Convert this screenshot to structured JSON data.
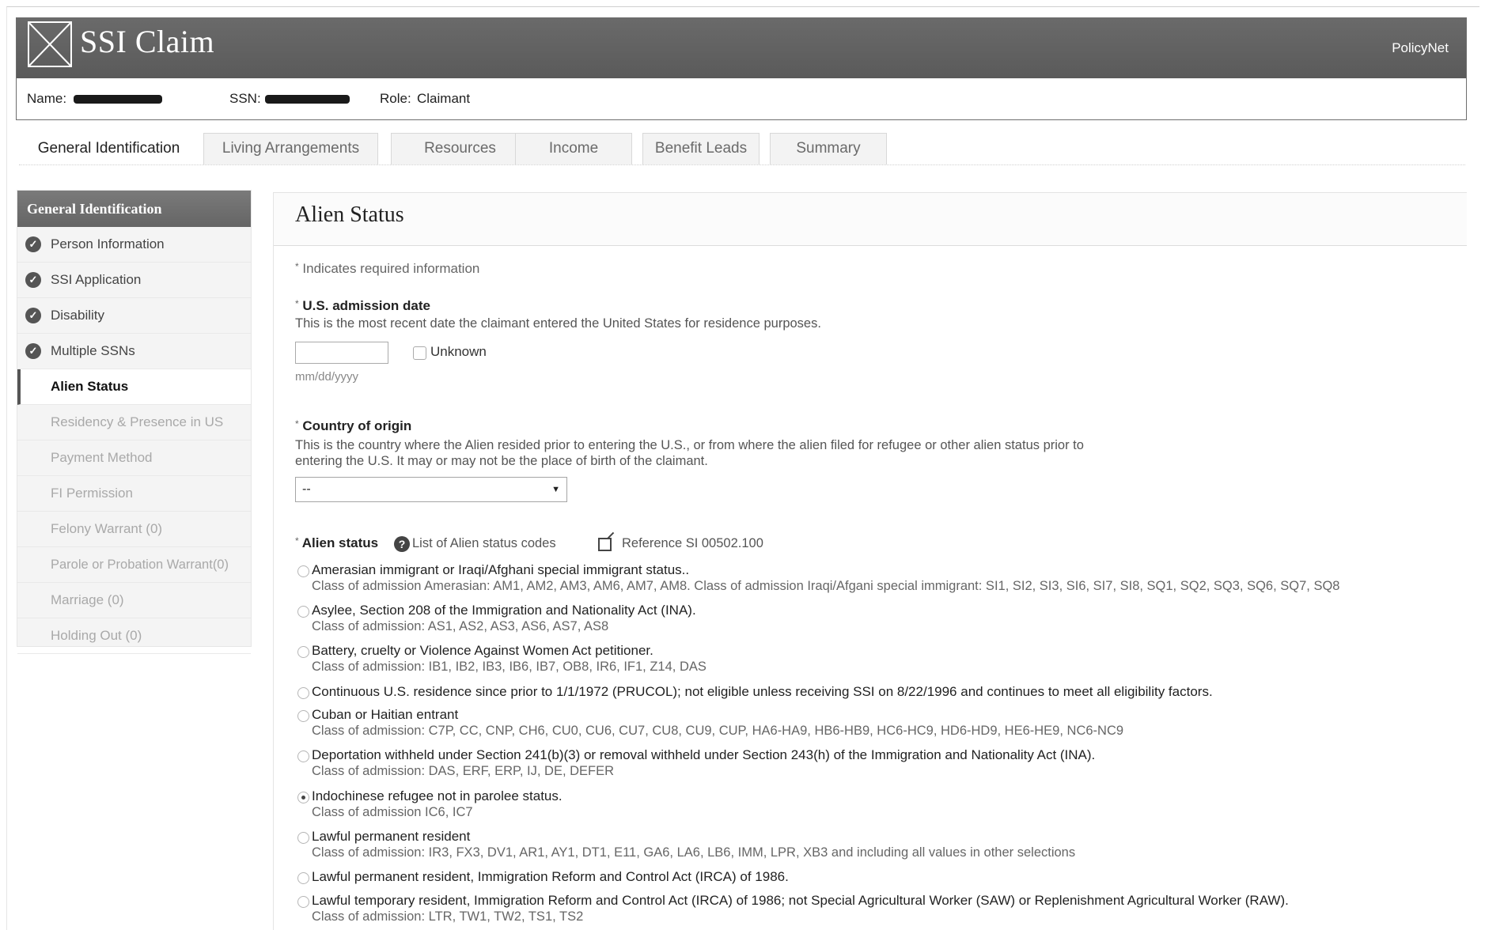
{
  "app": {
    "title": "SSI Claim",
    "vendor": "PolicyNet"
  },
  "claimant": {
    "name_label": "Name:",
    "ssn_label": "SSN:",
    "role_label": "Role:",
    "role_value": "Claimant"
  },
  "tabs": [
    {
      "label": "General Identification"
    },
    {
      "label": "Living Arrangements"
    },
    {
      "label": "Resources"
    },
    {
      "label": "Income"
    },
    {
      "label": "Benefit Leads"
    },
    {
      "label": "Summary"
    }
  ],
  "sidebar": {
    "header": "General Identification",
    "items": [
      {
        "label": "Person Information",
        "state": "complete"
      },
      {
        "label": "SSI Application",
        "state": "complete"
      },
      {
        "label": "Disability",
        "state": "complete"
      },
      {
        "label": "Multiple SSNs",
        "state": "complete"
      },
      {
        "label": "Alien Status",
        "state": "current"
      },
      {
        "label": "Residency & Presence in US",
        "state": "pending"
      },
      {
        "label": "Payment Method",
        "state": "pending"
      },
      {
        "label": "FI Permission",
        "state": "pending"
      },
      {
        "label": "Felony Warrant (0)",
        "state": "pending"
      },
      {
        "label": "Parole or Probation Warrant(0)",
        "state": "pending"
      },
      {
        "label": "Marriage (0)",
        "state": "pending"
      },
      {
        "label": "Holding Out (0)",
        "state": "pending"
      }
    ]
  },
  "main": {
    "title": "Alien Status",
    "required_note": "Indicates required information",
    "admission": {
      "label": "U.S. admission date",
      "help": "This is the most recent date the claimant entered the United States for residence purposes.",
      "value": "",
      "unknown_label": "Unknown",
      "unknown_checked": false,
      "format_hint": "mm/dd/yyyy"
    },
    "country": {
      "label": "Country of origin",
      "help_line1": "This is the country where the Alien resided prior to entering the U.S., or from where the alien filed for refugee or other alien status prior to",
      "help_line2": "entering the U.S. It may or may not be the place of birth of the claimant.",
      "selected": "--"
    },
    "alien_status": {
      "label": "Alien status",
      "codes_link": "List of Alien status codes",
      "reference_link": "Reference SI 00502.100",
      "options": [
        {
          "label": "Amerasian immigrant or Iraqi/Afghani special immigrant status..",
          "sub": "Class of admission Amerasian: AM1, AM2, AM3, AM6, AM7, AM8. Class of admission Iraqi/Afgani special immigrant: SI1, SI2, SI3, SI6, SI7, SI8, SQ1, SQ2, SQ3, SQ6, SQ7, SQ8",
          "selected": false
        },
        {
          "label": "Asylee, Section 208 of the Immigration and Nationality Act (INA).",
          "sub": "Class of admission: AS1, AS2, AS3, AS6, AS7, AS8",
          "selected": false
        },
        {
          "label": "Battery, cruelty or Violence Against Women Act petitioner.",
          "sub": "Class of admission: IB1, IB2, IB3, IB6, IB7, OB8, IR6, IF1, Z14, DAS",
          "selected": false
        },
        {
          "label": "Continuous U.S. residence since prior to 1/1/1972 (PRUCOL);  not eligible unless receiving SSI on 8/22/1996 and continues to meet all eligibility factors.",
          "sub": "",
          "selected": false
        },
        {
          "label": "Cuban or Haitian entrant",
          "sub": "Class of admission:  C7P, CC, CNP, CH6, CU0, CU6, CU7, CU8, CU9, CUP, HA6-HA9, HB6-HB9, HC6-HC9, HD6-HD9, HE6-HE9, NC6-NC9",
          "selected": false
        },
        {
          "label": "Deportation withheld under Section 241(b)(3) or removal withheld under Section 243(h) of the  Immigration and Nationality Act (INA).",
          "sub": "Class of admission: DAS, ERF, ERP, IJ, DE, DEFER",
          "selected": false
        },
        {
          "label": "Indochinese refugee not in parolee status.",
          "sub": "Class of admission IC6, IC7",
          "selected": true
        },
        {
          "label": "Lawful permanent resident",
          "sub": "Class of admission: IR3, FX3, DV1, AR1, AY1, DT1, E11, GA6, LA6, LB6, IMM, LPR, XB3 and including all values in other selections",
          "selected": false
        },
        {
          "label": "Lawful permanent resident, Immigration Reform and Control Act (IRCA) of 1986.",
          "sub": "",
          "selected": false
        },
        {
          "label": "Lawful temporary resident, Immigration Reform and Control Act (IRCA) of 1986; not Special Agricultural Worker (SAW) or Replenishment Agricultural Worker (RAW).",
          "sub": "Class of admission: LTR, TW1, TW2, TS1, TS2",
          "selected": false
        }
      ]
    }
  }
}
